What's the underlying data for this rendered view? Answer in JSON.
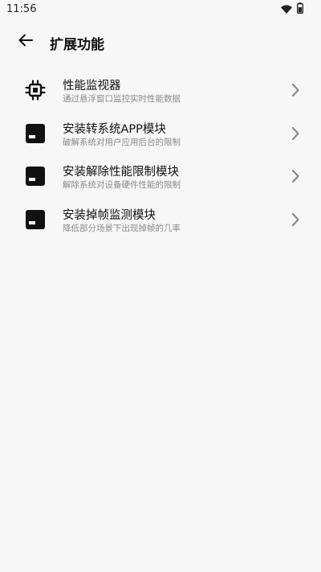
{
  "status_bar": {
    "time": "11:56",
    "icons": [
      "wifi-icon",
      "battery-icon"
    ]
  },
  "app_bar": {
    "back_icon": "arrow-left-icon",
    "title": "扩展功能"
  },
  "items": [
    {
      "icon": "cpu-chip-icon",
      "title": "性能监视器",
      "subtitle": "通过悬浮窗口监控实时性能数据"
    },
    {
      "icon": "module-icon",
      "title": "安装转系统APP模块",
      "subtitle": "破解系统对用户应用后台的限制"
    },
    {
      "icon": "module-icon",
      "title": "安装解除性能限制模块",
      "subtitle": "解除系统对设备硬件性能的限制"
    },
    {
      "icon": "module-icon",
      "title": "安装掉帧监测模块",
      "subtitle": "降低部分场景下出现掉帧的几率"
    }
  ],
  "colors": {
    "background": "#f7f7f7",
    "title_text": "#111111",
    "subtitle_text": "#8a8a8a",
    "chevron": "#8a8a8a"
  }
}
